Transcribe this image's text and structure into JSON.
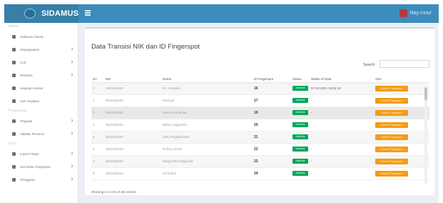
{
  "app": {
    "logo_text": "SIDAMUS",
    "user_name": "Nay mnur"
  },
  "sidebar": {
    "items": [
      {
        "type": "header",
        "label": "MENU"
      },
      {
        "type": "item",
        "label": "Halaman Utama",
        "icon": "home-icon",
        "chevron": false
      },
      {
        "type": "item",
        "label": "Kepegawaian",
        "icon": "book-icon",
        "chevron": true
      },
      {
        "type": "item",
        "label": "Cuti",
        "icon": "folder-icon",
        "chevron": true
      },
      {
        "type": "item",
        "label": "Presensi",
        "icon": "check-icon",
        "chevron": true
      },
      {
        "type": "item",
        "label": "Kegiatan Harian",
        "icon": "pen-icon",
        "chevron": false
      },
      {
        "type": "item",
        "label": "Jam Kegiatan",
        "icon": "clock-icon",
        "chevron": false
      },
      {
        "type": "header",
        "label": "Pengaturan"
      },
      {
        "type": "item",
        "label": "Pegawai",
        "icon": "user-icon",
        "chevron": true
      },
      {
        "type": "item",
        "label": "Validasi Presensi",
        "icon": "list-icon",
        "chevron": true
      },
      {
        "type": "header",
        "label": "Lihat"
      },
      {
        "type": "item",
        "label": "Import Finger",
        "icon": "upload-icon",
        "chevron": true
      },
      {
        "type": "item",
        "label": "Sesi Data Fingerprint",
        "icon": "fingerprint-icon",
        "chevron": true
      },
      {
        "type": "item",
        "label": "Pengguna",
        "icon": "users-icon",
        "chevron": true
      }
    ]
  },
  "main": {
    "title": "Data Transisi NIK dan ID Fingerspot",
    "search_label": "Search:",
    "search_value": "",
    "columns": [
      "No",
      "NIK",
      "Nama",
      "ID Fingerspot",
      "Status",
      "Waktu of Data",
      "Aksi"
    ],
    "rows": [
      {
        "no": "1",
        "nik": "3521182503",
        "nama": "Dr. N Maulid",
        "id_fingerspot": "16",
        "status": "Aktivitas",
        "waktu": "07-03-2021 15:04:18",
        "aksi": "Ubah ID Fingerspot"
      },
      {
        "no": "2",
        "nik": "3521182503",
        "nama": "Rismadi",
        "id_fingerspot": "17",
        "status": "Aktivitas",
        "waktu": "-",
        "aksi": "Ubah ID Fingerspot"
      },
      {
        "no": "3",
        "nik": "3521182503",
        "nama": "Dana Handaniati",
        "id_fingerspot": "19",
        "status": "Aktivitas",
        "waktu": "-",
        "aksi": "Ubah ID Fingerspot"
      },
      {
        "no": "4",
        "nik": "3521182503",
        "nama": "Witha Anggoraini",
        "id_fingerspot": "20",
        "status": "Aktivitas",
        "waktu": "",
        "aksi": "Ubah ID Fingerspot"
      },
      {
        "no": "5",
        "nik": "3521182503",
        "nama": "Jako Pagalariawan",
        "id_fingerspot": "21",
        "status": "Aktivitas",
        "waktu": "-",
        "aksi": "Ubah ID Fingerspot"
      },
      {
        "no": "6",
        "nik": "3521182503",
        "nama": "Rohmy Mardi",
        "id_fingerspot": "22",
        "status": "Aktivitas",
        "waktu": "-",
        "aksi": "Ubah ID Fingerspot"
      },
      {
        "no": "7",
        "nik": "3521182503",
        "nama": "Margaretha Magnolia",
        "id_fingerspot": "23",
        "status": "Aktivitas",
        "waktu": "-",
        "aksi": "Ubah ID Fingerspot"
      },
      {
        "no": "8",
        "nik": "3521182503",
        "nama": "Ali Rosidi",
        "id_fingerspot": "24",
        "status": "Aktivitas",
        "waktu": "-",
        "aksi": "Ubah ID Fingerspot"
      }
    ],
    "footer_info": "Showing 1 to 101 of 101 entries"
  },
  "colors": {
    "topbar": "#3c8dbc",
    "logo_bg": "#367fa9",
    "status_badge": "#00a65a",
    "action_button": "#f39c12"
  }
}
